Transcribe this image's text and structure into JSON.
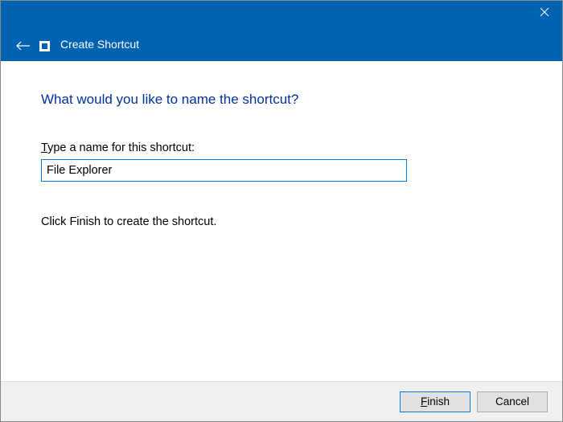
{
  "titlebar": {
    "title": "Create Shortcut"
  },
  "content": {
    "heading": "What would you like to name the shortcut?",
    "field_label_pre": "T",
    "field_label_rest": "ype a name for this shortcut:",
    "input_value": "File Explorer",
    "instruction": "Click Finish to create the shortcut."
  },
  "footer": {
    "finish_pre": "F",
    "finish_rest": "inish",
    "cancel": "Cancel"
  }
}
